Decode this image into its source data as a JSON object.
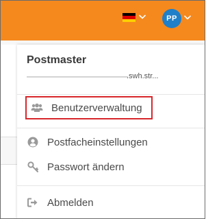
{
  "header": {
    "language_flag": "german-flag",
    "language_colors": [
      "#000000",
      "#dd0000",
      "#ffce00"
    ],
    "user_initials": "PP",
    "accent_color": "#f5891e",
    "avatar_color": "#1f7fc8"
  },
  "user_menu": {
    "username": "Postmaster",
    "email_domain": ".swh.str...",
    "items": [
      {
        "label": "Benutzerverwaltung",
        "icon": "users-icon",
        "highlighted": true
      },
      {
        "label": "Postfacheinstellungen",
        "icon": "user-circle-icon"
      },
      {
        "label": "Passwort ändern",
        "icon": "key-icon"
      },
      {
        "label": "Abmelden",
        "icon": "sign-out-icon"
      }
    ]
  }
}
